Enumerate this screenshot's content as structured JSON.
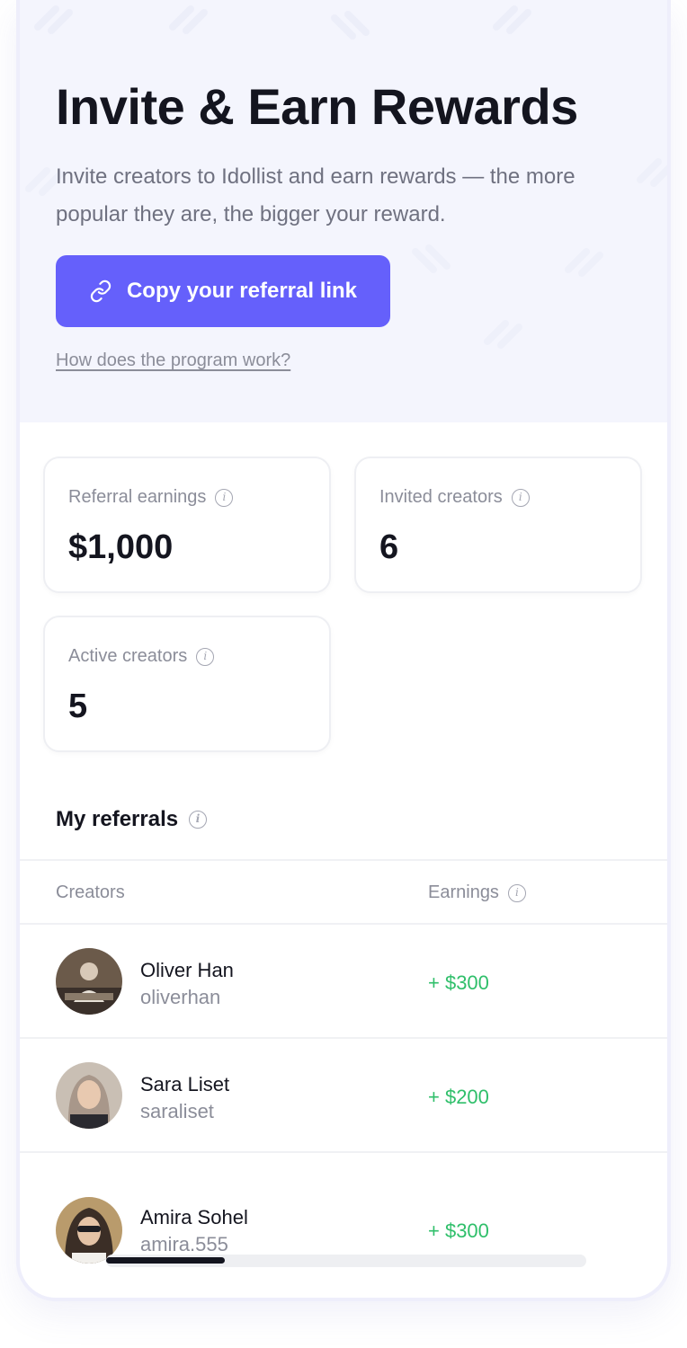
{
  "hero": {
    "title": "Invite & Earn Rewards",
    "subtitle": "Invite creators to Idollist and earn rewards — the more popular they are, the bigger your reward.",
    "cta_label": "Copy your referral link",
    "cta_icon": "link-icon",
    "help_link": "How does the program work?"
  },
  "stats": [
    {
      "label": "Referral earnings",
      "value": "$1,000"
    },
    {
      "label": "Invited creators",
      "value": "6"
    },
    {
      "label": "Active creators",
      "value": "5"
    }
  ],
  "referrals": {
    "title": "My referrals",
    "columns": {
      "creators": "Creators",
      "earnings": "Earnings"
    },
    "rows": [
      {
        "name": "Oliver Han",
        "handle": "oliverhan",
        "earnings": "+ $300",
        "avatar": "avatar-photo"
      },
      {
        "name": "Sara Liset",
        "handle": "saraliset",
        "earnings": "+ $200",
        "avatar": "avatar-photo"
      },
      {
        "name": "Amira Sohel",
        "handle": "amira.555",
        "earnings": "+ $300",
        "avatar": "avatar-photo"
      }
    ]
  },
  "colors": {
    "accent": "#6560fb",
    "positive": "#2fbf6a",
    "hero_bg": "#f4f5fd"
  },
  "scrollbar": {
    "position": 0.0
  }
}
